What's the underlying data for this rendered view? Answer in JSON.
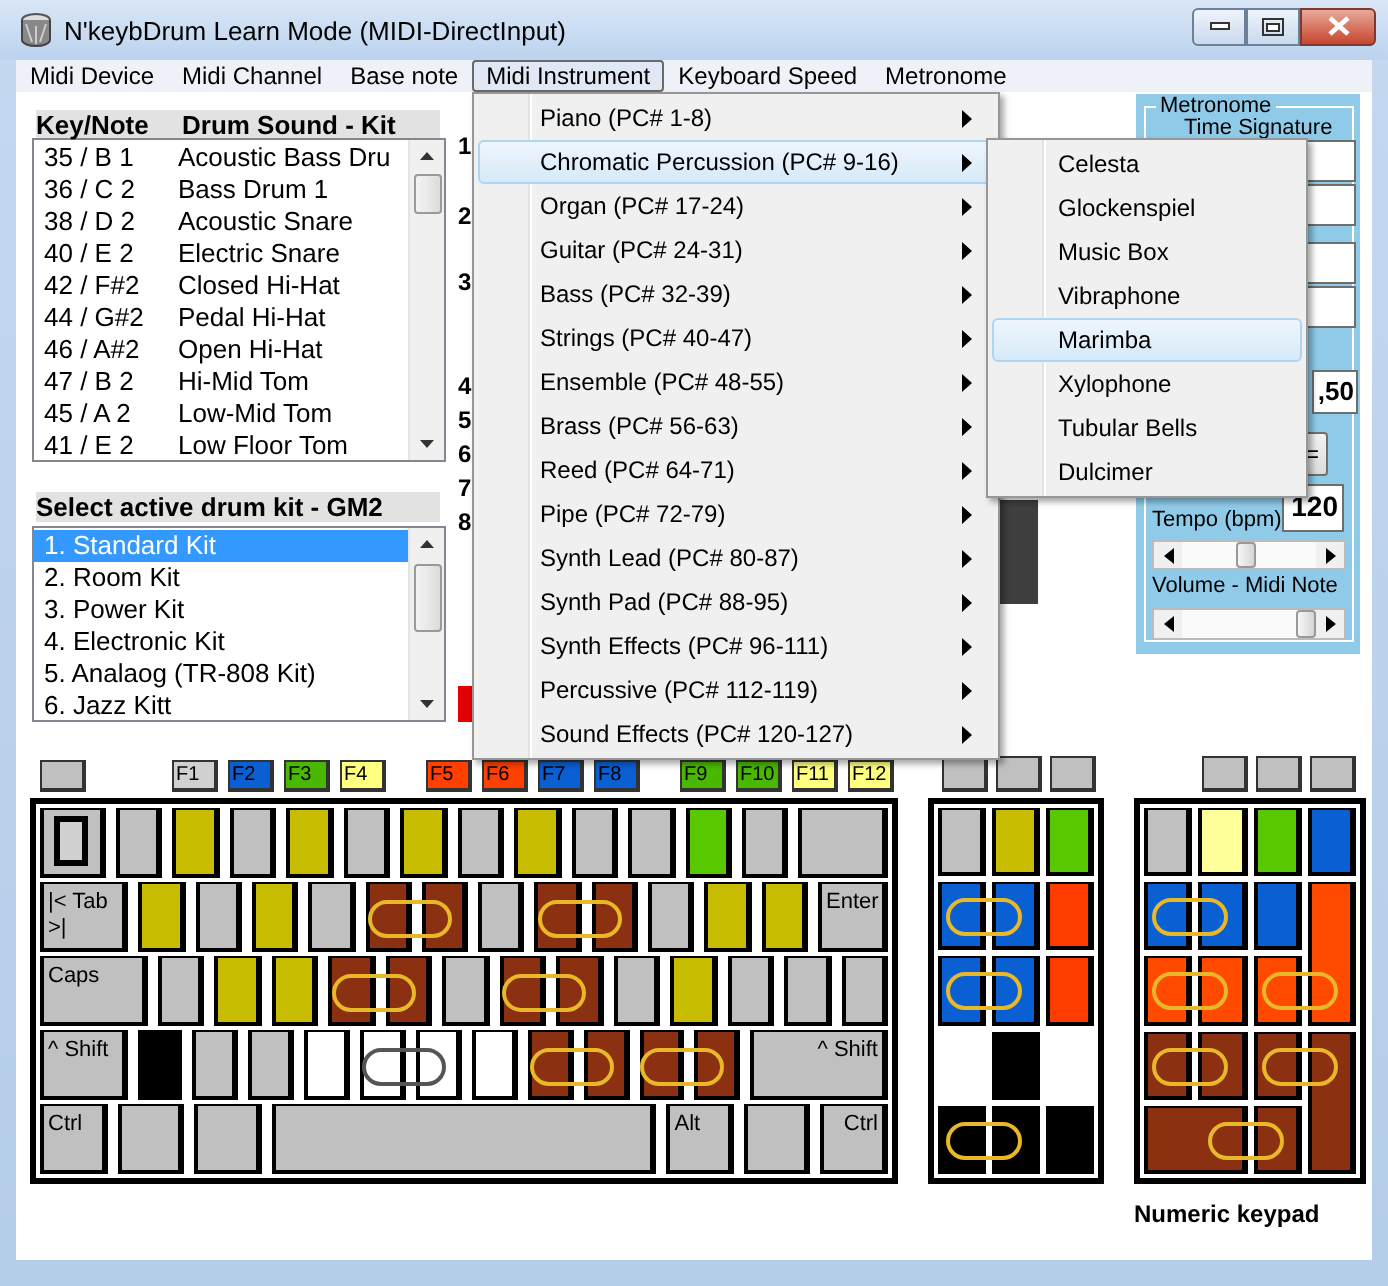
{
  "window": {
    "title": "N'keybDrum Learn Mode (MIDI-DirectInput)"
  },
  "menu_bar": [
    {
      "label": "Midi Device",
      "selected": false
    },
    {
      "label": "Midi Channel",
      "selected": false
    },
    {
      "label": "Base note",
      "selected": false
    },
    {
      "label": "Midi Instrument",
      "selected": true
    },
    {
      "label": "Keyboard Speed",
      "selected": false
    },
    {
      "label": "Metronome",
      "selected": false
    }
  ],
  "drum_sounds": {
    "header_key": "Key/Note",
    "header_sound": "Drum Sound - Kit",
    "rows": [
      {
        "note": "35 / B 1",
        "sound": "Acoustic Bass Dru"
      },
      {
        "note": "36 / C 2",
        "sound": "Bass Drum 1"
      },
      {
        "note": "38 / D 2",
        "sound": "Acoustic Snare"
      },
      {
        "note": "40 / E 2",
        "sound": "Electric Snare"
      },
      {
        "note": "42 / F#2",
        "sound": "Closed Hi-Hat"
      },
      {
        "note": "44 / G#2",
        "sound": "Pedal Hi-Hat"
      },
      {
        "note": "46 / A#2",
        "sound": "Open Hi-Hat"
      },
      {
        "note": "47 / B 2",
        "sound": "Hi-Mid Tom"
      },
      {
        "note": "45 / A 2",
        "sound": "Low-Mid Tom"
      },
      {
        "note": "41 / E 2",
        "sound": "Low Floor Tom"
      }
    ]
  },
  "drum_kits": {
    "header": "Select active drum kit - GM2",
    "items": [
      {
        "label": "1. Standard Kit",
        "selected": true
      },
      {
        "label": "2. Room Kit",
        "selected": false
      },
      {
        "label": "3. Power Kit",
        "selected": false
      },
      {
        "label": "4. Electronic Kit",
        "selected": false
      },
      {
        "label": "5. Analaog (TR-808 Kit)",
        "selected": false
      },
      {
        "label": "6. Jazz Kitt",
        "selected": false
      }
    ]
  },
  "row_numbers": [
    "1",
    "2",
    "3",
    "4",
    "5",
    "6",
    "7",
    "8"
  ],
  "metronome": {
    "title": "Metronome",
    "time_signature_label": "Time Signature",
    "fraction_value": ",50",
    "button_fragment": "=",
    "tempo_label": "Tempo (bpm)",
    "tempo_value": "120",
    "tempo_slider": {
      "level": 0.48
    },
    "volume_label": "Volume - Midi Note",
    "volume_slider": {
      "level": 0.93
    }
  },
  "function_keys": [
    {
      "keys": [
        {
          "color": "#c0c0c0"
        }
      ]
    },
    {
      "keys": [
        {
          "label": "F1",
          "color": "#d0d0d0"
        },
        {
          "label": "F2",
          "color": "#0a5fd2"
        },
        {
          "label": "F3",
          "color": "#48b800"
        },
        {
          "label": "F4",
          "color": "#ffff80"
        }
      ]
    },
    {
      "keys": [
        {
          "label": "F5",
          "color": "#ff4000"
        },
        {
          "label": "F6",
          "color": "#ff4000"
        },
        {
          "label": "F7",
          "color": "#0a5fd2"
        },
        {
          "label": "F8",
          "color": "#0a5fd2"
        }
      ]
    },
    {
      "keys": [
        {
          "label": "F9",
          "color": "#48b800"
        },
        {
          "label": "F10",
          "color": "#48b800"
        },
        {
          "label": "F11",
          "color": "#ffff80"
        },
        {
          "label": "F12",
          "color": "#ffff80"
        }
      ]
    }
  ],
  "main_keyboard": {
    "rows": [
      {
        "keys": [
          {
            "kind": "framed",
            "color": "#c0c0c0"
          },
          {
            "kind": "key",
            "color": "#c0c0c0"
          },
          {
            "kind": "key",
            "color": "#c8bc00"
          },
          {
            "kind": "key",
            "color": "#c0c0c0"
          },
          {
            "kind": "key",
            "color": "#c8bc00"
          },
          {
            "kind": "key",
            "color": "#c0c0c0"
          },
          {
            "kind": "key",
            "color": "#c8bc00"
          },
          {
            "kind": "key",
            "color": "#c0c0c0"
          },
          {
            "kind": "key",
            "color": "#c8bc00"
          },
          {
            "kind": "key",
            "color": "#c0c0c0"
          },
          {
            "kind": "key",
            "color": "#c0c0c0"
          },
          {
            "kind": "key",
            "color": "#58c800"
          },
          {
            "kind": "key",
            "color": "#c0c0c0"
          },
          {
            "kind": "wider",
            "color": "#c0c0c0"
          }
        ]
      },
      {
        "keys": [
          {
            "kind": "wider",
            "color": "#c0c0c0",
            "label": "|< Tab\n>|"
          },
          {
            "kind": "key",
            "color": "#c8bc00"
          },
          {
            "kind": "key",
            "color": "#c0c0c0"
          },
          {
            "kind": "key",
            "color": "#c8bc00"
          },
          {
            "kind": "key",
            "color": "#c0c0c0"
          },
          {
            "kind": "key",
            "color": "#8b3010",
            "linked": true
          },
          {
            "kind": "key",
            "color": "#8b3010"
          },
          {
            "kind": "key",
            "color": "#c0c0c0"
          },
          {
            "kind": "key",
            "color": "#8b3010",
            "linked": true
          },
          {
            "kind": "key",
            "color": "#8b3010"
          },
          {
            "kind": "key",
            "color": "#c0c0c0"
          },
          {
            "kind": "key",
            "color": "#c8bc00"
          },
          {
            "kind": "key",
            "color": "#c8bc00"
          },
          {
            "kind": "wide",
            "color": "#c0c0c0",
            "label": "Enter"
          }
        ]
      },
      {
        "keys": [
          {
            "kind": "widest",
            "color": "#c0c0c0",
            "label": "Caps"
          },
          {
            "kind": "key",
            "color": "#c0c0c0"
          },
          {
            "kind": "key",
            "color": "#c8bc00"
          },
          {
            "kind": "key",
            "color": "#c8bc00"
          },
          {
            "kind": "key",
            "color": "#8b3010",
            "linked": true
          },
          {
            "kind": "key",
            "color": "#8b3010"
          },
          {
            "kind": "key",
            "color": "#c0c0c0"
          },
          {
            "kind": "key",
            "color": "#8b3010",
            "linked": true
          },
          {
            "kind": "key",
            "color": "#8b3010"
          },
          {
            "kind": "key",
            "color": "#c0c0c0"
          },
          {
            "kind": "key",
            "color": "#c8bc00"
          },
          {
            "kind": "key",
            "color": "#c0c0c0"
          },
          {
            "kind": "key",
            "color": "#c0c0c0"
          },
          {
            "kind": "key",
            "color": "#c0c0c0"
          }
        ]
      },
      {
        "keys": [
          {
            "kind": "wider",
            "color": "#c0c0c0",
            "label": "^ Shift"
          },
          {
            "kind": "key",
            "color": "#000000"
          },
          {
            "kind": "key",
            "color": "#c0c0c0"
          },
          {
            "kind": "key",
            "color": "#c0c0c0"
          },
          {
            "kind": "key",
            "color": "#ffffff"
          },
          {
            "kind": "key",
            "color": "#ffffff",
            "linked": true
          },
          {
            "kind": "key",
            "color": "#ffffff"
          },
          {
            "kind": "key",
            "color": "#ffffff"
          },
          {
            "kind": "key",
            "color": "#8b3010",
            "linked": true
          },
          {
            "kind": "key",
            "color": "#8b3010"
          },
          {
            "kind": "key",
            "color": "#8b3010",
            "linked": true
          },
          {
            "kind": "key",
            "color": "#8b3010"
          },
          {
            "kind": "xl",
            "color": "#c0c0c0",
            "label": "^ Shift"
          }
        ]
      },
      {
        "keys": [
          {
            "kind": "wide",
            "color": "#c0c0c0",
            "label": "Ctrl"
          },
          {
            "kind": "wide",
            "color": "#c0c0c0"
          },
          {
            "kind": "wide",
            "color": "#c0c0c0"
          },
          {
            "kind": "space",
            "color": "#c0c0c0"
          },
          {
            "kind": "wide",
            "color": "#c0c0c0",
            "label": "Alt"
          },
          {
            "kind": "wide",
            "color": "#c0c0c0"
          },
          {
            "kind": "wide",
            "color": "#c0c0c0",
            "label": "Ctrl"
          }
        ]
      }
    ]
  },
  "nav_keys": {
    "top_keys": [
      {
        "color": "#c0c0c0"
      },
      {
        "color": "#c0c0c0"
      },
      {
        "color": "#c0c0c0"
      }
    ],
    "keys": [
      {
        "kind": "key",
        "color": "#c0c0c0"
      },
      {
        "kind": "key",
        "color": "#c8bc00"
      },
      {
        "kind": "key",
        "color": "#58c800"
      },
      {
        "kind": "key",
        "color": "#0a5fd2",
        "linked": true
      },
      {
        "kind": "key",
        "color": "#0a5fd2"
      },
      {
        "kind": "key",
        "color": "#ff3c00"
      },
      {
        "kind": "key",
        "color": "#0a5fd2",
        "linked": true
      },
      {
        "kind": "key",
        "color": "#0a5fd2"
      },
      {
        "kind": "key",
        "color": "#ff3c00"
      },
      {
        "kind": "empty"
      },
      {
        "kind": "key",
        "color": "#000000"
      },
      {
        "kind": "empty"
      },
      {
        "kind": "key",
        "color": "#000000",
        "linked": true
      },
      {
        "kind": "key",
        "color": "#000000"
      },
      {
        "kind": "key",
        "color": "#000000"
      }
    ]
  },
  "numeric_keypad": {
    "top_keys": [
      {
        "color": "#c0c0c0"
      },
      {
        "color": "#c0c0c0"
      },
      {
        "color": "#c0c0c0"
      }
    ],
    "keys": [
      {
        "kind": "key",
        "color": "#c0c0c0"
      },
      {
        "kind": "key",
        "color": "#ffff99"
      },
      {
        "kind": "key",
        "color": "#58c800"
      },
      {
        "kind": "key",
        "color": "#0a5fd2"
      },
      {
        "kind": "key",
        "color": "#0a5fd2",
        "linked": true
      },
      {
        "kind": "key",
        "color": "#0a5fd2"
      },
      {
        "kind": "key",
        "color": "#0a5fd2"
      },
      {
        "kind": "tall",
        "color": "#ff4a00"
      },
      {
        "kind": "key",
        "color": "#ff4a00",
        "linked": true
      },
      {
        "kind": "key",
        "color": "#ff4a00"
      },
      {
        "kind": "key",
        "color": "#ff4a00",
        "linked": true
      },
      {
        "kind": "key",
        "color": "#8b3010",
        "linked": true
      },
      {
        "kind": "key",
        "color": "#8b3010"
      },
      {
        "kind": "key",
        "color": "#8b3010",
        "linked": true
      },
      {
        "kind": "tall",
        "color": "#8b3010"
      },
      {
        "kind": "wide",
        "color": "#8b3010",
        "linked": true
      },
      {
        "kind": "key",
        "color": "#8b3010"
      }
    ],
    "caption": "Numeric keypad"
  },
  "open_menu": {
    "items": [
      {
        "label": "Piano (PC# 1-8)",
        "selected": false,
        "has_submenu": true
      },
      {
        "label": "Chromatic Percussion (PC# 9-16)",
        "selected": true,
        "has_submenu": true
      },
      {
        "label": "Organ (PC# 17-24)",
        "selected": false,
        "has_submenu": true
      },
      {
        "label": "Guitar (PC# 24-31)",
        "selected": false,
        "has_submenu": true
      },
      {
        "label": "Bass (PC# 32-39)",
        "selected": false,
        "has_submenu": true
      },
      {
        "label": "Strings (PC# 40-47)",
        "selected": false,
        "has_submenu": true
      },
      {
        "label": "Ensemble (PC# 48-55)",
        "selected": false,
        "has_submenu": true
      },
      {
        "label": "Brass (PC# 56-63)",
        "selected": false,
        "has_submenu": true
      },
      {
        "label": "Reed (PC# 64-71)",
        "selected": false,
        "has_submenu": true
      },
      {
        "label": "Pipe (PC# 72-79)",
        "selected": false,
        "has_submenu": true
      },
      {
        "label": "Synth Lead (PC# 80-87)",
        "selected": false,
        "has_submenu": true
      },
      {
        "label": "Synth Pad (PC# 88-95)",
        "selected": false,
        "has_submenu": true
      },
      {
        "label": "Synth Effects (PC# 96-111)",
        "selected": false,
        "has_submenu": true
      },
      {
        "label": "Percussive (PC# 112-119)",
        "selected": false,
        "has_submenu": true
      },
      {
        "label": "Sound Effects (PC# 120-127)",
        "selected": false,
        "has_submenu": true
      }
    ]
  },
  "submenu": {
    "items": [
      {
        "label": "Celesta",
        "selected": false
      },
      {
        "label": "Glockenspiel",
        "selected": false
      },
      {
        "label": "Music Box",
        "selected": false
      },
      {
        "label": "Vibraphone",
        "selected": false
      },
      {
        "label": "Marimba",
        "selected": true
      },
      {
        "label": "Xylophone",
        "selected": false
      },
      {
        "label": "Tubular Bells",
        "selected": false
      },
      {
        "label": "Dulcimer",
        "selected": false
      }
    ]
  }
}
